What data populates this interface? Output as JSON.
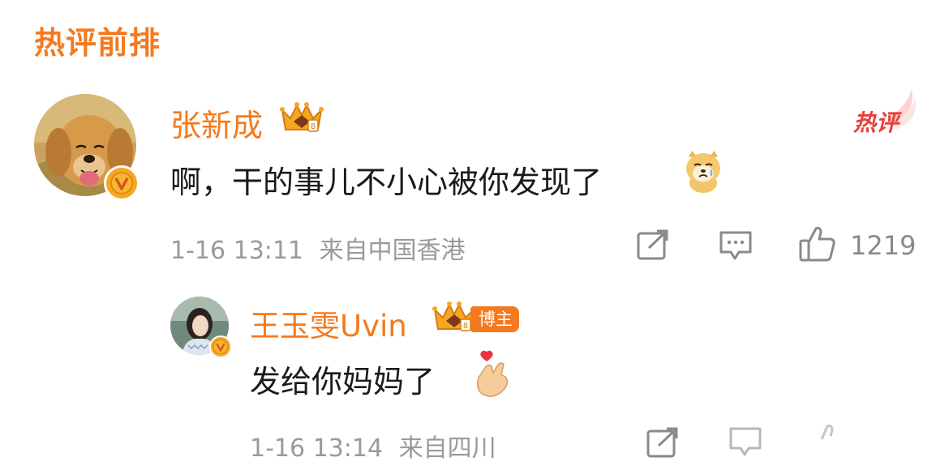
{
  "section_title": "热评前排",
  "comment": {
    "username": "张新成",
    "text": "啊，干的事儿不小心被你发现了",
    "emoji": "crying-dog-emoji",
    "time": "1-16 13:11",
    "location": "来自中国香港",
    "hot_badge": "热评",
    "like_count": "1219"
  },
  "reply": {
    "username": "王玉雯Uvin",
    "tag": "博主",
    "text": "发给你妈妈了",
    "emoji": "finger-heart-emoji",
    "time": "1-16 13:14",
    "location": "来自四川"
  },
  "colors": {
    "accent": "#f47a1f",
    "text": "#1a1a1a",
    "meta": "#9a9a9a",
    "hot": "#e8403c",
    "verified": "#f6a623"
  }
}
